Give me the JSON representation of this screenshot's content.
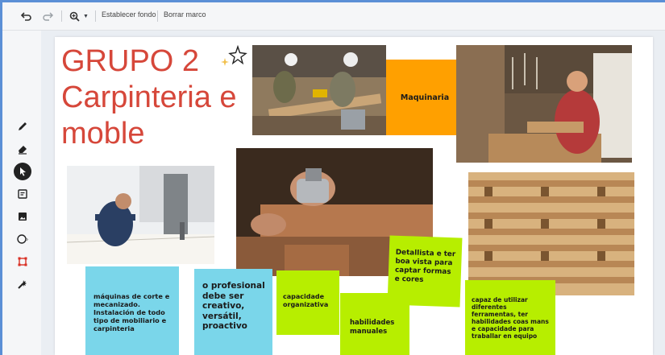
{
  "toolbar": {
    "undo_icon": "undo-icon",
    "redo_icon": "redo-icon",
    "zoom_icon": "zoom-icon",
    "set_background_label": "Establecer fondo",
    "clear_frame_label": "Borrar marco"
  },
  "sidebar": {
    "tools": [
      "pen-icon",
      "eraser-icon",
      "select-pointer-icon",
      "sticky-note-icon",
      "image-icon",
      "circle-shape-icon",
      "frame-select-icon",
      "laser-pointer-icon"
    ]
  },
  "board": {
    "title": "GRUPO 2 Carpinteria e moble",
    "colors": {
      "title": "#d6473a",
      "orange": "#ffa000",
      "cyan": "#7ad6ea",
      "green": "#b7ee00"
    },
    "notes": {
      "maquinaria": "Maquinaria",
      "maquinas": "máquinas de corte e mecanizado. Instalación de todo tipo de mobiliario e carpinteria",
      "profesional": "o profesional debe ser creativo, versátil, proactivo",
      "capacidade": "capacidade organizativa",
      "habilidades": "habilidades manuales",
      "detallista": "Detallista e ter boa vista para captar formas e cores",
      "ferramentas": "capaz de utilizar diferentes ferramentas, ter habilidades coas mans e capacidade para traballar en equipo"
    }
  }
}
